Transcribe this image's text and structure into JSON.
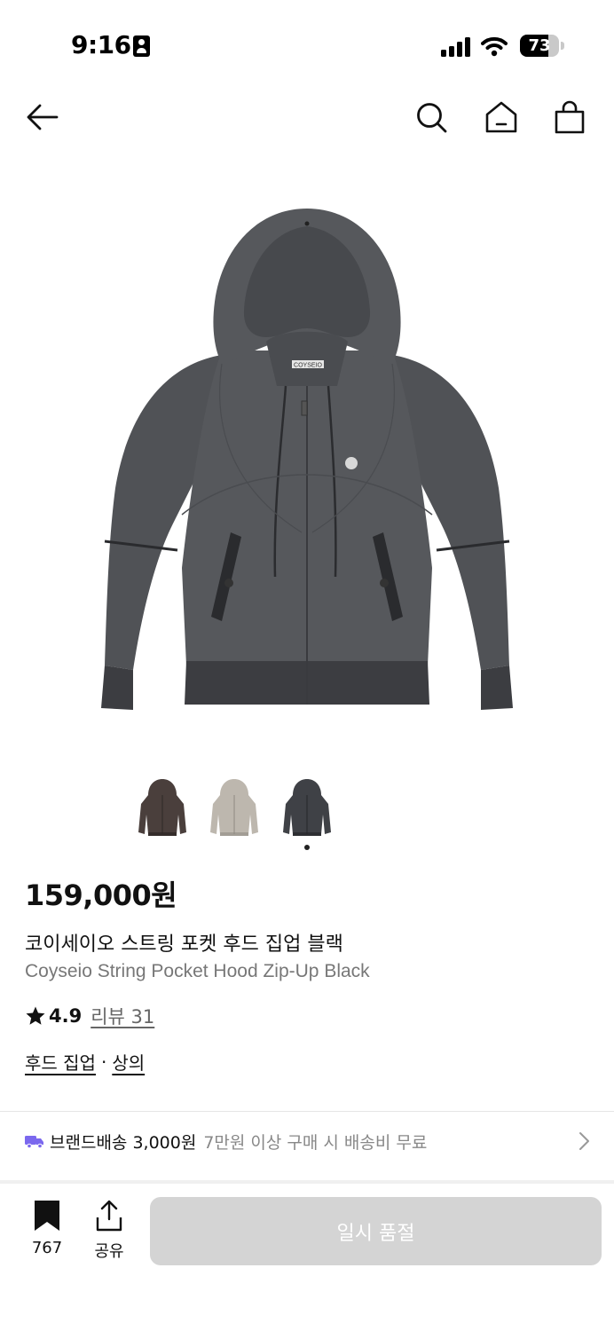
{
  "status_bar": {
    "time": "9:16",
    "battery": "73",
    "battery_level": 0.73
  },
  "nav": {
    "back_icon": "arrow-left-icon",
    "search_icon": "search-icon",
    "home_icon": "home-icon",
    "cart_icon": "shopping-bag-icon"
  },
  "product": {
    "price": "159,000원",
    "name_ko": "코이세이오 스트링 포켓 후드 집업 블랙",
    "name_en": "Coyseio String Pocket Hood Zip-Up Black",
    "rating": "4.9",
    "review_link": "리뷰 31",
    "category_primary": "후드 집업",
    "category_separator": "·",
    "category_secondary": "상의",
    "tag_label": "COYSEIO",
    "color_options": [
      {
        "color": "#4a3f3c",
        "selected": false
      },
      {
        "color": "#bdb7ae",
        "selected": false
      },
      {
        "color": "#3f4146",
        "selected": true
      }
    ]
  },
  "shipping": {
    "label": "브랜드배송 3,000원",
    "note": "7만원 이상 구매 시 배송비 무료",
    "icon": "truck-icon",
    "accent": "#7b68ee"
  },
  "bottom_bar": {
    "bookmark_count": "767",
    "share_label": "공유",
    "soldout_label": "일시 품절"
  },
  "colors": {
    "hoodie_main": "#56585c",
    "hoodie_shadow": "#47494d",
    "button_disabled": "#d4d4d4"
  }
}
